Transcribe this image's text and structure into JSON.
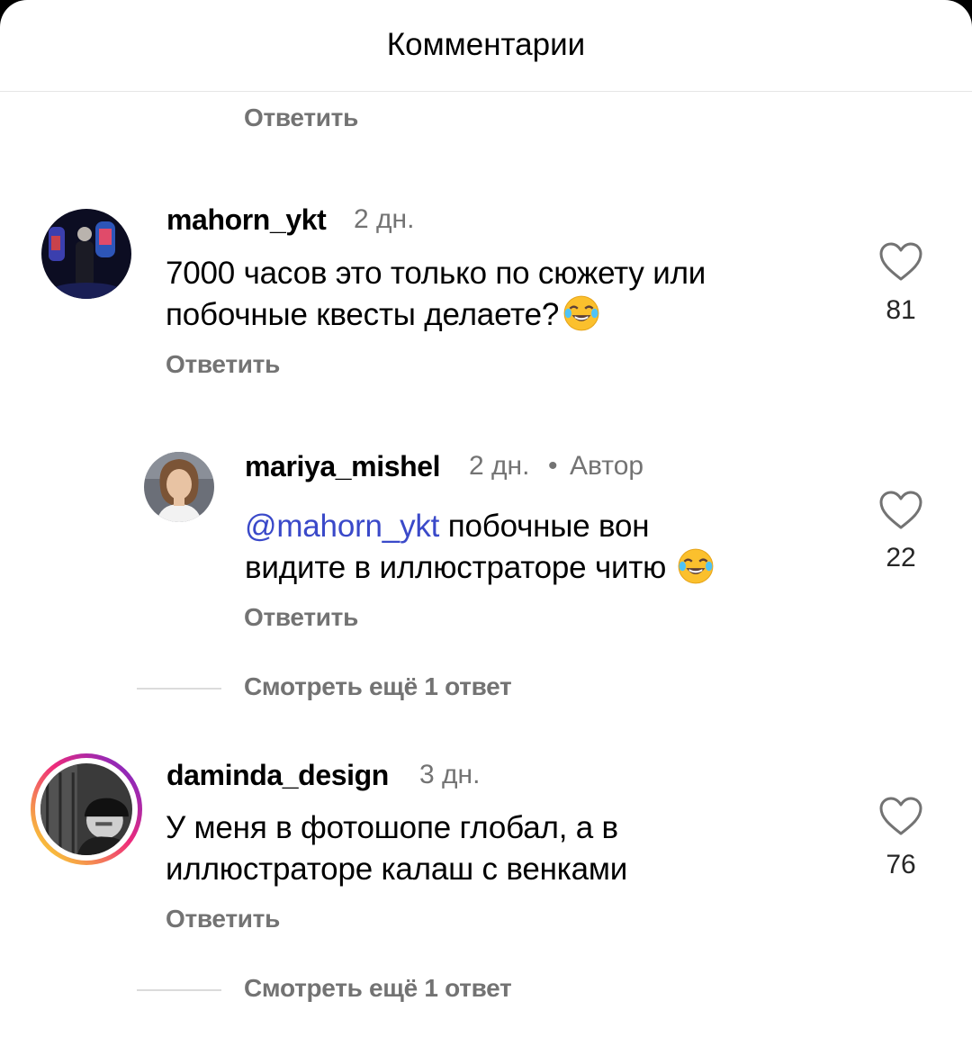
{
  "header": {
    "title": "Комментарии"
  },
  "top_reply": {
    "reply_label": "Ответить"
  },
  "comments": [
    {
      "username": "mahorn_ykt",
      "time": "2 дн.",
      "text": "7000 часов это только по сюжету или побочные квесты делаете?",
      "text_line1": "7000 часов это только по сюжету или",
      "text_line2": "побочные квесты делаете?",
      "emoji": "face-with-tears-of-joy",
      "likes": "81",
      "reply_label": "Ответить",
      "avatar": "dark-concert-photo"
    },
    {
      "username": "mariya_mishel",
      "time": "2 дн.",
      "badge": "Автор",
      "mention": "@mahorn_ykt",
      "text_line1_rest": " побочные вон",
      "text_line2": "видите в иллюстраторе читю",
      "emoji": "face-with-tears-of-joy",
      "likes": "22",
      "reply_label": "Ответить",
      "avatar": "woman-portrait"
    },
    {
      "username": "daminda_design",
      "time": "3 дн.",
      "text_line1": "У меня в фотошопе глобал, а в",
      "text_line2": "иллюстраторе калаш с венками",
      "likes": "76",
      "reply_label": "Ответить",
      "avatar": "bw-man-in-cap",
      "story_ring": true
    }
  ],
  "view_more": [
    {
      "label": "Смотреть ещё 1 ответ"
    },
    {
      "label": "Смотреть ещё 1 ответ"
    }
  ],
  "colors": {
    "mention": "#3a49c9",
    "secondary_text": "#737373",
    "story_ring": [
      "#f9ce34",
      "#ee2a7b",
      "#6228d7"
    ]
  }
}
